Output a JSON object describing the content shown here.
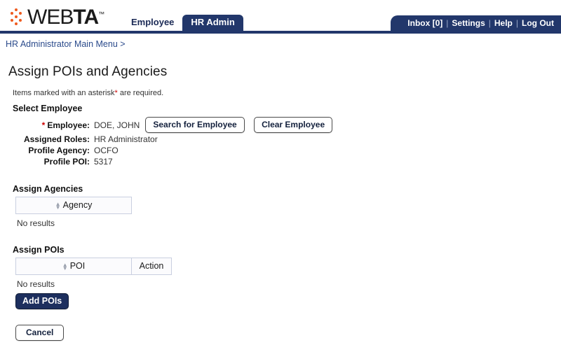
{
  "header": {
    "logo": {
      "text_web": "WEB",
      "text_ta": "TA",
      "trademark": "™",
      "dot_color": "#ef5a1e"
    },
    "tabs": [
      {
        "label": "Employee",
        "active": false
      },
      {
        "label": "HR Admin",
        "active": true
      }
    ],
    "nav": {
      "inbox": "Inbox [0]",
      "settings": "Settings",
      "help": "Help",
      "logout": "Log Out",
      "separator": "|"
    },
    "accent_color": "#22376b"
  },
  "breadcrumb": {
    "items": [
      "HR Administrator Main Menu"
    ],
    "separator": ">"
  },
  "page": {
    "title": "Assign POIs and Agencies",
    "required_note_prefix": "Items marked with an asterisk",
    "required_note_star": "*",
    "required_note_suffix": " are required."
  },
  "select_employee": {
    "section_title": "Select Employee",
    "rows": [
      {
        "label": "Employee:",
        "value": "DOE, JOHN",
        "required": true
      },
      {
        "label": "Assigned Roles:",
        "value": "HR Administrator",
        "required": false
      },
      {
        "label": "Profile Agency:",
        "value": "OCFO",
        "required": false
      },
      {
        "label": "Profile POI:",
        "value": "5317",
        "required": false
      }
    ],
    "search_button": "Search for Employee",
    "clear_button": "Clear Employee",
    "asterisk": "*"
  },
  "assign_agencies": {
    "title": "Assign Agencies",
    "columns": [
      "Agency"
    ],
    "rows": [],
    "empty_text": "No results"
  },
  "assign_pois": {
    "title": "Assign POIs",
    "columns": [
      "POI",
      "Action"
    ],
    "rows": [],
    "empty_text": "No results",
    "add_button": "Add POIs"
  },
  "footer": {
    "cancel_button": "Cancel"
  }
}
